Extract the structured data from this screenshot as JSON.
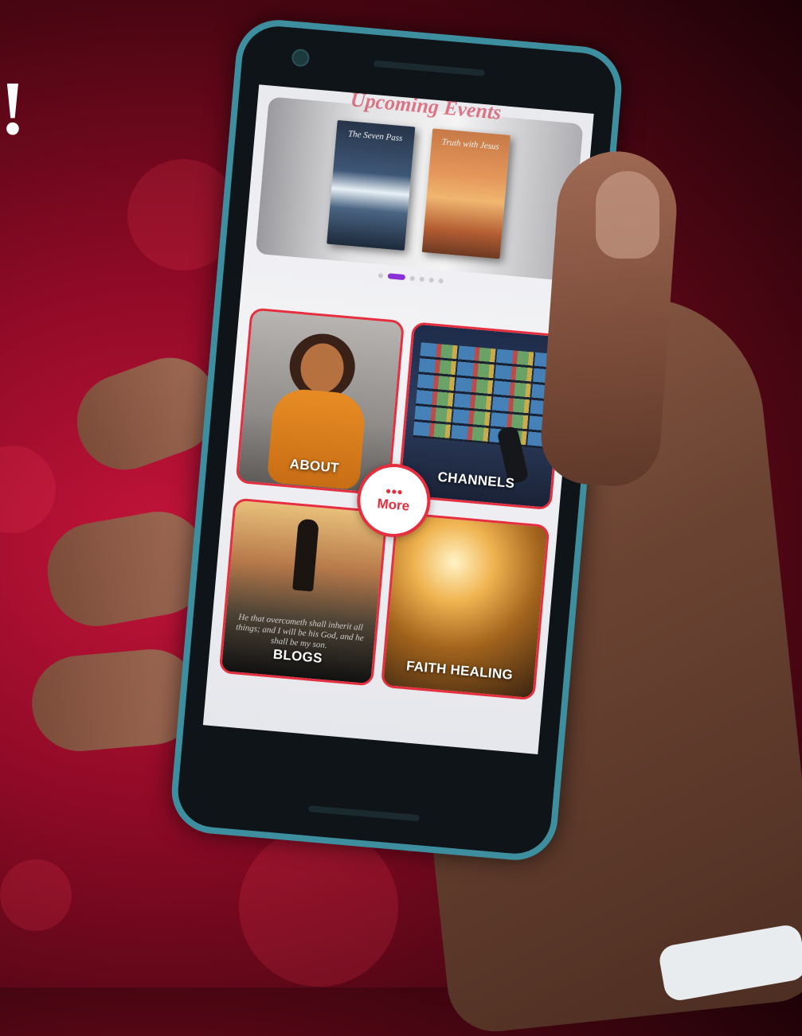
{
  "background": {
    "mark": "!"
  },
  "carousel": {
    "section_title": "Upcoming Events",
    "books": [
      {
        "title": "The Seven Pass",
        "author": ""
      },
      {
        "title": "Truth with Jesus",
        "author": ""
      }
    ],
    "pages": 7,
    "active_page": 2
  },
  "tiles": {
    "about": "ABOUT",
    "channels": "CHANNELS",
    "blogs": "BLOGS",
    "faith_healing": "FAITH HEALING"
  },
  "blogs_quote": "He that overcometh shall inherit all things; and I will be his God, and he shall be my son.",
  "more_button": {
    "dots": "•••",
    "label": "More"
  },
  "colors": {
    "accent": "#e52f3f",
    "indicator": "#8b2fd6",
    "background": "#8e0a26"
  }
}
